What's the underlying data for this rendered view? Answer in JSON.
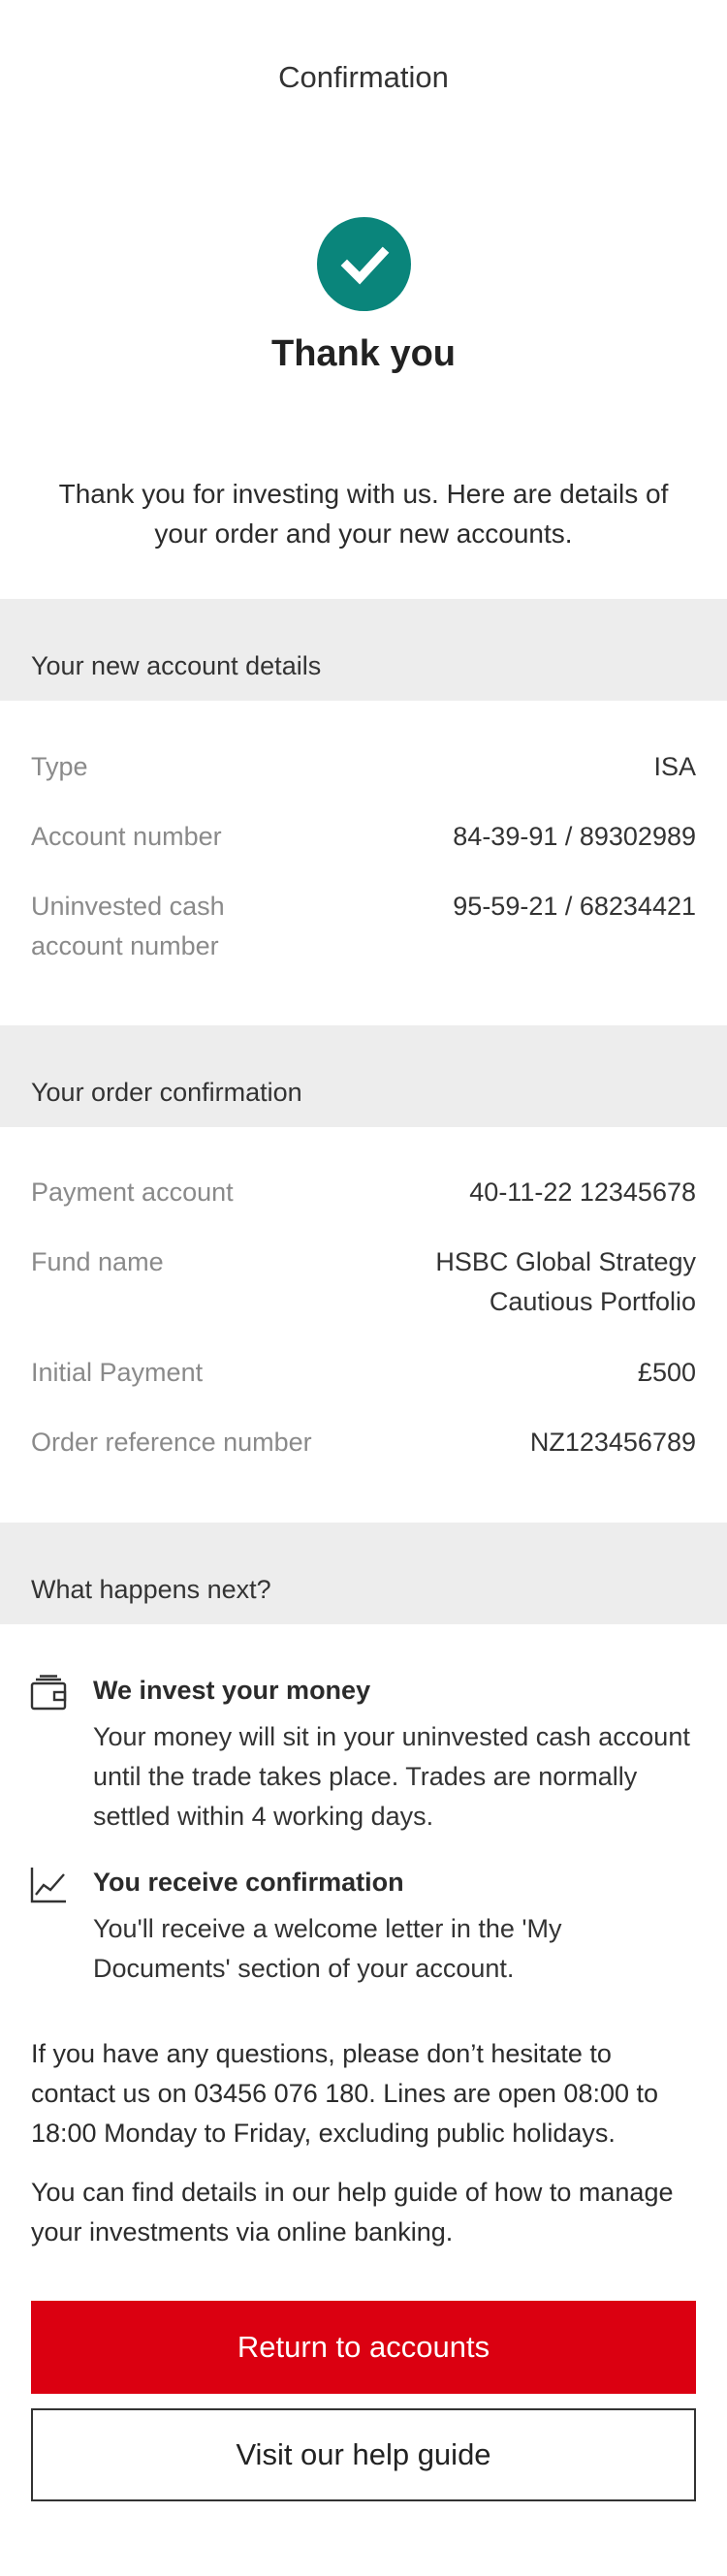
{
  "header": {
    "title": "Confirmation"
  },
  "hero": {
    "heading": "Thank you",
    "check_color": "#0a857b",
    "check_icon": "checkmark-icon"
  },
  "intro": "Thank you for investing with us. Here are details of your order and your new accounts.",
  "account_section": {
    "title": "Your new account details",
    "rows": [
      {
        "label": "Type",
        "value": "ISA"
      },
      {
        "label": "Account number",
        "value": "84-39-91 / 89302989"
      },
      {
        "label_line1": "Uninvested cash",
        "label_line2": "account number",
        "value": "95-59-21 / 68234421"
      }
    ]
  },
  "order_section": {
    "title": "Your order confirmation",
    "rows": [
      {
        "label": "Payment account",
        "value": "40-11-22 12345678"
      },
      {
        "label": "Fund name",
        "value_line1": "HSBC Global Strategy",
        "value_line2": "Cautious Portfolio"
      },
      {
        "label": "Initial Payment",
        "value": "£500"
      },
      {
        "label": "Order reference number",
        "value": "NZ123456789"
      }
    ]
  },
  "next_section": {
    "title": "What happens next?",
    "steps": [
      {
        "icon": "wallet-icon",
        "title": "We invest your money",
        "text": "Your money will sit in your uninvested cash account until the trade takes place. Trades are normally settled within 4 working days."
      },
      {
        "icon": "chart-icon",
        "title": "You receive confirmation",
        "text": "You'll receive a welcome letter in the 'My Documents' section of your account."
      }
    ]
  },
  "contact_text": "If you have any questions, please don’t hesitate to contact us on 03456 076 180. Lines are open 08:00 to 18:00 Monday to Friday, excluding public holidays.",
  "help_text": "You can find details in our help guide of how to manage your investments via online banking.",
  "buttons": {
    "primary": "Return to accounts",
    "secondary": "Visit our help guide",
    "primary_color": "#db0011"
  }
}
